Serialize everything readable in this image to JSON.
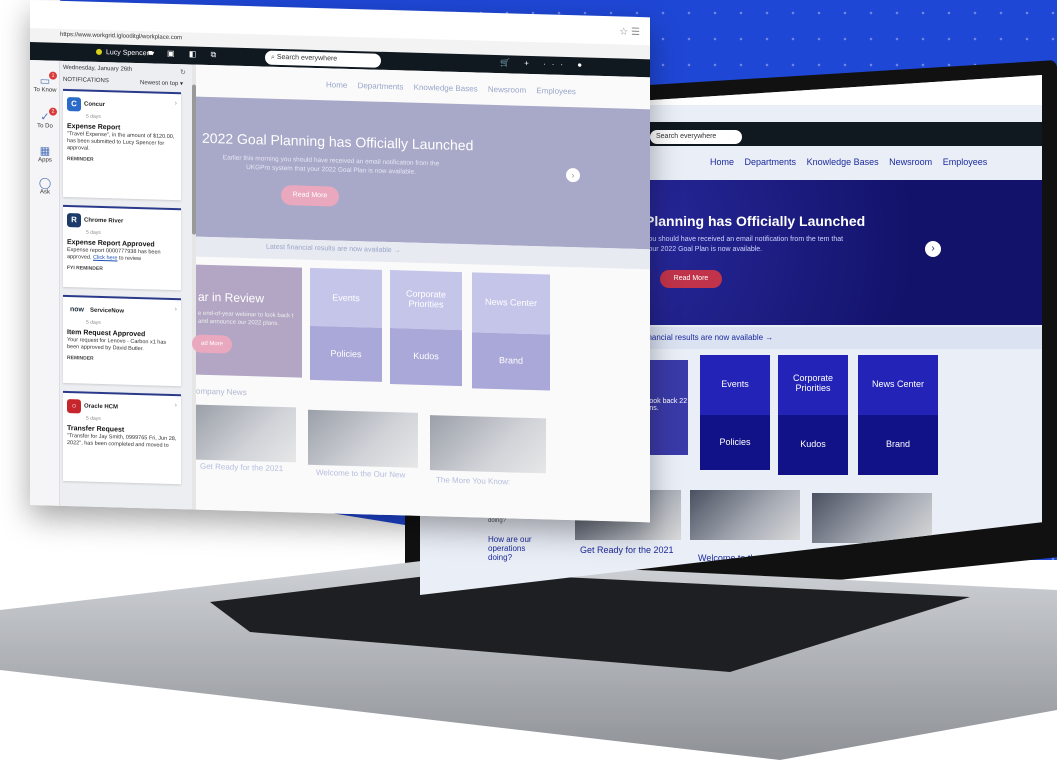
{
  "browser": {
    "url": "https://www.workgrid.iglooditgl/workplace.com",
    "user_name": "Lucy Spencer",
    "search_placeholder": "Search everywhere"
  },
  "rail": {
    "items": [
      {
        "label": "To Know",
        "badge": "1"
      },
      {
        "label": "To Do",
        "badge": "2"
      },
      {
        "label": "Apps"
      },
      {
        "label": "Ask"
      }
    ]
  },
  "notifications": {
    "date": "Wednesday, January 26th",
    "heading": "NOTIFICATIONS",
    "sort": "Newest on top",
    "cards": [
      {
        "app": "Concur",
        "age": "5 days",
        "title": "Expense Report",
        "body": "\"Travel Expense\", in the amount of $120.00, has been submitted to Lucy Spencer for approval.",
        "tag": "REMINDER"
      },
      {
        "app": "Chrome River",
        "age": "5 days",
        "title": "Expense Report Approved",
        "body_pre": "Expense report 0000777938 has been approved. ",
        "link": "Click here",
        "body_post": " to review",
        "tag": "FYI REMINDER"
      },
      {
        "app": "ServiceNow",
        "age": "5 days",
        "title": "Item Request Approved",
        "body": "Your request for Lenovo - Carbon x1 has been approved by David Butler.",
        "tag": "REMINDER"
      },
      {
        "app": "Oracle HCM",
        "age": "5 days",
        "title": "Transfer Request",
        "body": "\"Transfer for Jay Smith, 0999765 Fri, Jun 28, 2022\", has been completed and moved to"
      }
    ]
  },
  "nav": {
    "items": [
      "Home",
      "Departments",
      "Knowledge Bases",
      "Newsroom",
      "Employees"
    ]
  },
  "hero": {
    "title": "2022 Goal Planning has Officially Launched",
    "title_laptop": "Planning has Officially Launched",
    "text": "Earlier this morning you should have received an email notification from the UKGPro system that your 2022 Goal Plan is now available.",
    "text_laptop": "you should have received an email notification from the tem that your 2022 Goal Plan is now available.",
    "button": "Read More"
  },
  "strip": {
    "text": "Latest financial results are now available →",
    "text_laptop": "st financial results are now available →"
  },
  "review": {
    "title": "ar in Review",
    "text": "e end-of-year webinar to look back t and announce our 2022 plans.",
    "text_laptop": "to look back 22 plans.",
    "button": "ad More"
  },
  "tiles": [
    "Events",
    "Corporate Priorities",
    "News Center",
    "Policies",
    "Kudos",
    "Brand"
  ],
  "company_news": {
    "heading": "ompany News",
    "captions": [
      "Get Ready for the 2021",
      "Welcome to the Our New",
      "The More You Know:"
    ]
  },
  "feedback": {
    "text": "and you give us feedback. How are our operations doing?",
    "link": "How are our operations doing?"
  }
}
